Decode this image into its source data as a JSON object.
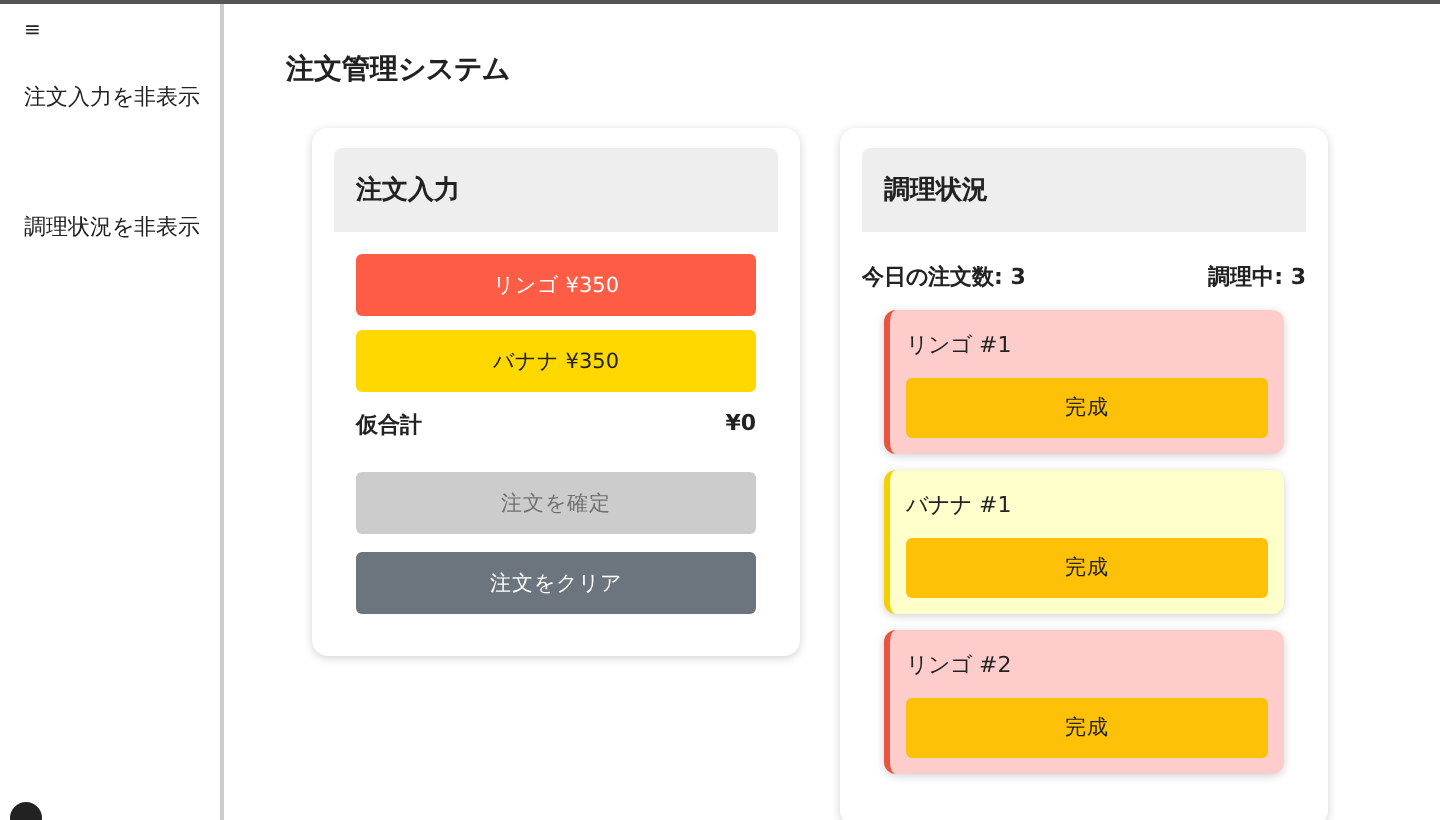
{
  "sidebar": {
    "menu_icon": "≡",
    "items": [
      {
        "label": "注文入力を非表示"
      },
      {
        "label": "調理状況を非表示"
      }
    ]
  },
  "title": "注文管理システム",
  "order_input": {
    "title": "注文入力",
    "menu": [
      {
        "label": "リンゴ ¥350",
        "color": "#ff5c45"
      },
      {
        "label": "バナナ ¥350",
        "color": "#ffd800"
      }
    ],
    "subtotal_label": "仮合計",
    "subtotal": "¥0",
    "actions": [
      {
        "label": "注文を確定",
        "disabled": true
      },
      {
        "label": "注文をクリア",
        "disabled": false
      }
    ]
  },
  "cooking_status": {
    "title": "調理状況",
    "orders_today": "今日の注文数: 3",
    "in_progress": "調理中: 3",
    "orders": [
      {
        "kind": "apple",
        "name": "リンゴ #1",
        "button": "完成"
      },
      {
        "kind": "banana",
        "name": "バナナ #1",
        "button": "完成"
      },
      {
        "kind": "apple",
        "name": "リンゴ #2",
        "button": "完成"
      }
    ]
  }
}
